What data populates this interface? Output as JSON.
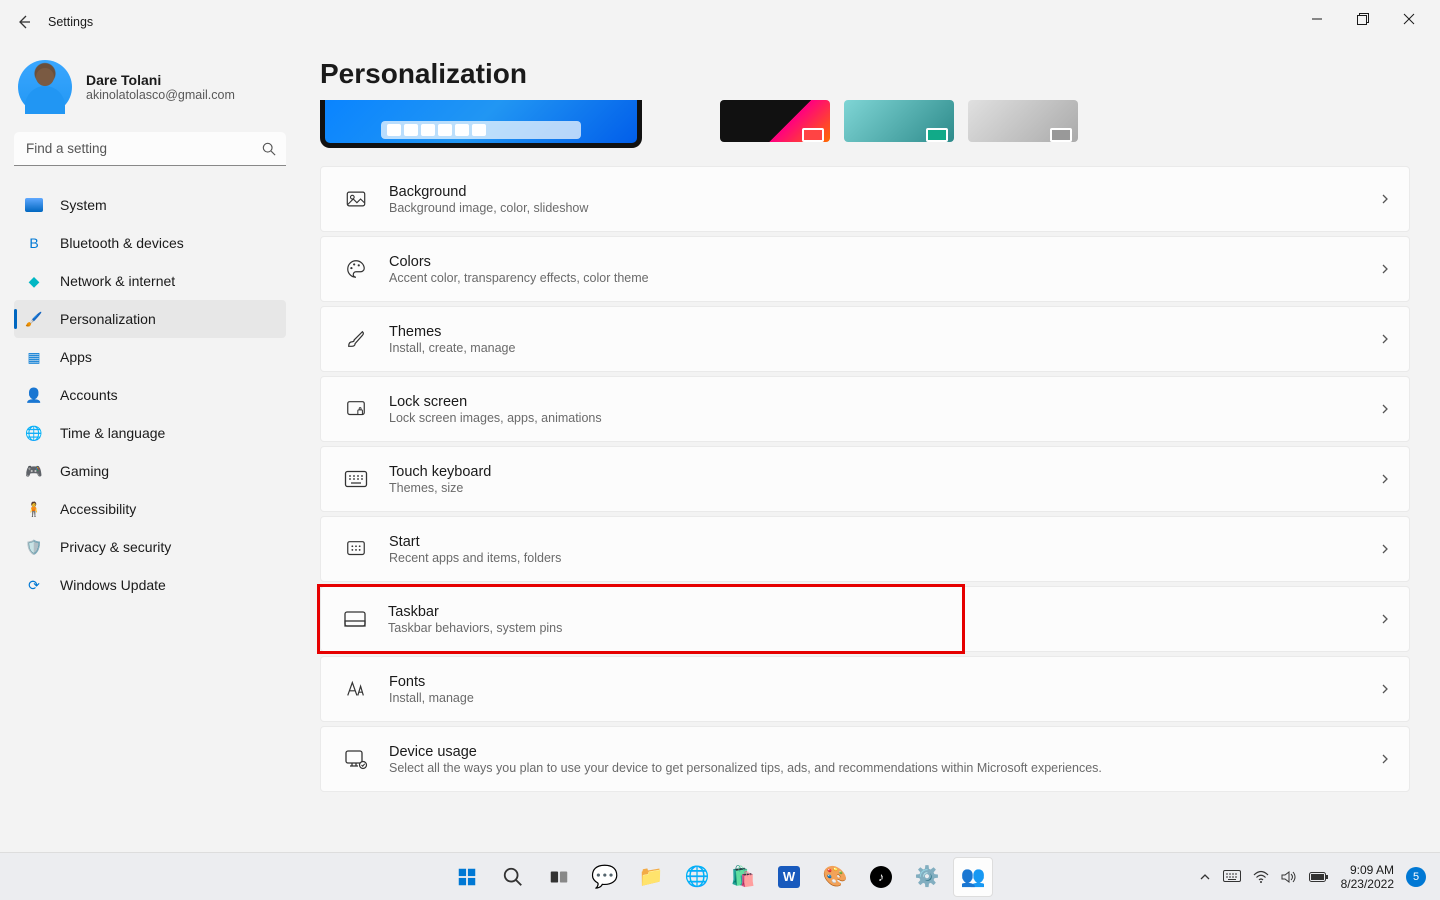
{
  "window": {
    "title": "Settings"
  },
  "user": {
    "name": "Dare Tolani",
    "email": "akinolatolasco@gmail.com"
  },
  "search": {
    "placeholder": "Find a setting"
  },
  "nav": [
    {
      "label": "System",
      "icon": "system-icon",
      "active": false
    },
    {
      "label": "Bluetooth & devices",
      "icon": "bluetooth-icon",
      "active": false
    },
    {
      "label": "Network & internet",
      "icon": "network-icon",
      "active": false
    },
    {
      "label": "Personalization",
      "icon": "personalization-icon",
      "active": true
    },
    {
      "label": "Apps",
      "icon": "apps-icon",
      "active": false
    },
    {
      "label": "Accounts",
      "icon": "accounts-icon",
      "active": false
    },
    {
      "label": "Time & language",
      "icon": "time-language-icon",
      "active": false
    },
    {
      "label": "Gaming",
      "icon": "gaming-icon",
      "active": false
    },
    {
      "label": "Accessibility",
      "icon": "accessibility-icon",
      "active": false
    },
    {
      "label": "Privacy & security",
      "icon": "privacy-icon",
      "active": false
    },
    {
      "label": "Windows Update",
      "icon": "update-icon",
      "active": false
    }
  ],
  "page": {
    "title": "Personalization"
  },
  "themes": [
    {
      "id": "preview-current",
      "icon": "desktop-preview"
    },
    {
      "id": "theme-dark-red",
      "icon": "theme-tile-1"
    },
    {
      "id": "theme-teal",
      "icon": "theme-tile-2"
    },
    {
      "id": "theme-light-gray",
      "icon": "theme-tile-3"
    }
  ],
  "cards": [
    {
      "title": "Background",
      "subtitle": "Background image, color, slideshow",
      "icon": "picture-icon",
      "highlight": false
    },
    {
      "title": "Colors",
      "subtitle": "Accent color, transparency effects, color theme",
      "icon": "palette-icon",
      "highlight": false
    },
    {
      "title": "Themes",
      "subtitle": "Install, create, manage",
      "icon": "brush-icon",
      "highlight": false
    },
    {
      "title": "Lock screen",
      "subtitle": "Lock screen images, apps, animations",
      "icon": "lockscreen-icon",
      "highlight": false
    },
    {
      "title": "Touch keyboard",
      "subtitle": "Themes, size",
      "icon": "keyboard-icon",
      "highlight": false
    },
    {
      "title": "Start",
      "subtitle": "Recent apps and items, folders",
      "icon": "start-icon",
      "highlight": false
    },
    {
      "title": "Taskbar",
      "subtitle": "Taskbar behaviors, system pins",
      "icon": "taskbar-icon",
      "highlight": true
    },
    {
      "title": "Fonts",
      "subtitle": "Install, manage",
      "icon": "fonts-icon",
      "highlight": false
    },
    {
      "title": "Device usage",
      "subtitle": "Select all the ways you plan to use your device to get personalized tips, ads, and recommendations within Microsoft experiences.",
      "icon": "device-usage-icon",
      "highlight": false
    }
  ],
  "taskbar": {
    "apps": [
      {
        "name": "start",
        "icon": "windows-start-icon"
      },
      {
        "name": "search",
        "icon": "search-icon"
      },
      {
        "name": "task-view",
        "icon": "taskview-icon"
      },
      {
        "name": "chat",
        "icon": "chat-icon"
      },
      {
        "name": "file-explorer",
        "icon": "folder-icon"
      },
      {
        "name": "edge",
        "icon": "edge-icon"
      },
      {
        "name": "store",
        "icon": "store-icon"
      },
      {
        "name": "word",
        "icon": "word-icon"
      },
      {
        "name": "paint",
        "icon": "paint-icon"
      },
      {
        "name": "tiktok",
        "icon": "tiktok-icon"
      },
      {
        "name": "settings",
        "icon": "gear-icon"
      },
      {
        "name": "teams",
        "icon": "teams-icon",
        "active": true
      }
    ],
    "tray": {
      "chevron": "chevron-up-icon",
      "keyboard": "osk-icon",
      "wifi": "wifi-icon",
      "volume": "volume-icon",
      "battery": "battery-icon",
      "time": "9:09 AM",
      "date": "8/23/2022",
      "notifications": "5"
    }
  }
}
